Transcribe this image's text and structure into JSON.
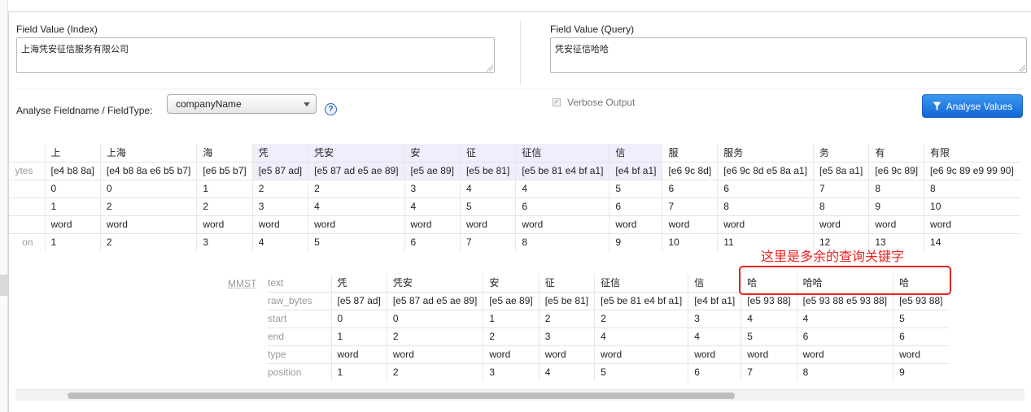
{
  "index": {
    "label": "Field Value (Index)",
    "value": "上海凭安征信服务有限公司"
  },
  "query": {
    "label": "Field Value (Query)",
    "value": "凭安征信哈哈"
  },
  "analyse": {
    "label": "Analyse Fieldname / FieldType:",
    "selected": "companyName",
    "help": "?",
    "verbose_label": "Verbose Output",
    "verbose_checked": true,
    "button_label": "Analyse Values"
  },
  "index_table": {
    "row_labels": [
      "ytes",
      "",
      "",
      "",
      "on"
    ],
    "columns": [
      {
        "text": "上",
        "raw_bytes": "[e4 b8 8a]",
        "start": "0",
        "end": "1",
        "type": "word",
        "position": "1",
        "hl": false
      },
      {
        "text": "上海",
        "raw_bytes": "[e4 b8 8a e6 b5 b7]",
        "start": "0",
        "end": "2",
        "type": "word",
        "position": "2",
        "hl": false
      },
      {
        "text": "海",
        "raw_bytes": "[e6 b5 b7]",
        "start": "1",
        "end": "2",
        "type": "word",
        "position": "3",
        "hl": false
      },
      {
        "text": "凭",
        "raw_bytes": "[e5 87 ad]",
        "start": "2",
        "end": "3",
        "type": "word",
        "position": "4",
        "hl": true
      },
      {
        "text": "凭安",
        "raw_bytes": "[e5 87 ad e5 ae 89]",
        "start": "2",
        "end": "4",
        "type": "word",
        "position": "5",
        "hl": true
      },
      {
        "text": "安",
        "raw_bytes": "[e5 ae 89]",
        "start": "3",
        "end": "4",
        "type": "word",
        "position": "6",
        "hl": true
      },
      {
        "text": "征",
        "raw_bytes": "[e5 be 81]",
        "start": "4",
        "end": "5",
        "type": "word",
        "position": "7",
        "hl": true
      },
      {
        "text": "征信",
        "raw_bytes": "[e5 be 81 e4 bf a1]",
        "start": "4",
        "end": "6",
        "type": "word",
        "position": "8",
        "hl": true
      },
      {
        "text": "信",
        "raw_bytes": "[e4 bf a1]",
        "start": "5",
        "end": "6",
        "type": "word",
        "position": "9",
        "hl": true
      },
      {
        "text": "服",
        "raw_bytes": "[e6 9c 8d]",
        "start": "6",
        "end": "7",
        "type": "word",
        "position": "10",
        "hl": false
      },
      {
        "text": "服务",
        "raw_bytes": "[e6 9c 8d e5 8a a1]",
        "start": "6",
        "end": "8",
        "type": "word",
        "position": "11",
        "hl": false
      },
      {
        "text": "务",
        "raw_bytes": "[e5 8a a1]",
        "start": "7",
        "end": "8",
        "type": "word",
        "position": "12",
        "hl": false
      },
      {
        "text": "有",
        "raw_bytes": "[e6 9c 89]",
        "start": "8",
        "end": "9",
        "type": "word",
        "position": "13",
        "hl": false
      },
      {
        "text": "有限",
        "raw_bytes": "[e6 9c 89 e9 99 90]",
        "start": "8",
        "end": "10",
        "type": "word",
        "position": "14",
        "hl": false
      }
    ]
  },
  "query_table": {
    "analyzer": "MMST",
    "row_labels": [
      "text",
      "raw_bytes",
      "start",
      "end",
      "type",
      "position"
    ],
    "columns": [
      {
        "text": "凭",
        "raw_bytes": "[e5 87 ad]",
        "start": "0",
        "end": "1",
        "type": "word",
        "position": "1"
      },
      {
        "text": "凭安",
        "raw_bytes": "[e5 87 ad e5 ae 89]",
        "start": "0",
        "end": "2",
        "type": "word",
        "position": "2"
      },
      {
        "text": "安",
        "raw_bytes": "[e5 ae 89]",
        "start": "1",
        "end": "2",
        "type": "word",
        "position": "3"
      },
      {
        "text": "征",
        "raw_bytes": "[e5 be 81]",
        "start": "2",
        "end": "3",
        "type": "word",
        "position": "4"
      },
      {
        "text": "征信",
        "raw_bytes": "[e5 be 81 e4 bf a1]",
        "start": "2",
        "end": "4",
        "type": "word",
        "position": "5"
      },
      {
        "text": "信",
        "raw_bytes": "[e4 bf a1]",
        "start": "3",
        "end": "4",
        "type": "word",
        "position": "6"
      },
      {
        "text": "哈",
        "raw_bytes": "[e5 93 88]",
        "start": "4",
        "end": "5",
        "type": "word",
        "position": "7"
      },
      {
        "text": "哈哈",
        "raw_bytes": "[e5 93 88 e5 93 88]",
        "start": "4",
        "end": "6",
        "type": "word",
        "position": "8"
      },
      {
        "text": "哈",
        "raw_bytes": "[e5 93 88]",
        "start": "5",
        "end": "6",
        "type": "word",
        "position": "9"
      }
    ]
  },
  "annotation": {
    "text": "这里是多余的查询关键字",
    "color": "#e8221e"
  },
  "colors": {
    "accent": "#1566d6",
    "highlight": "#eeeefc"
  }
}
